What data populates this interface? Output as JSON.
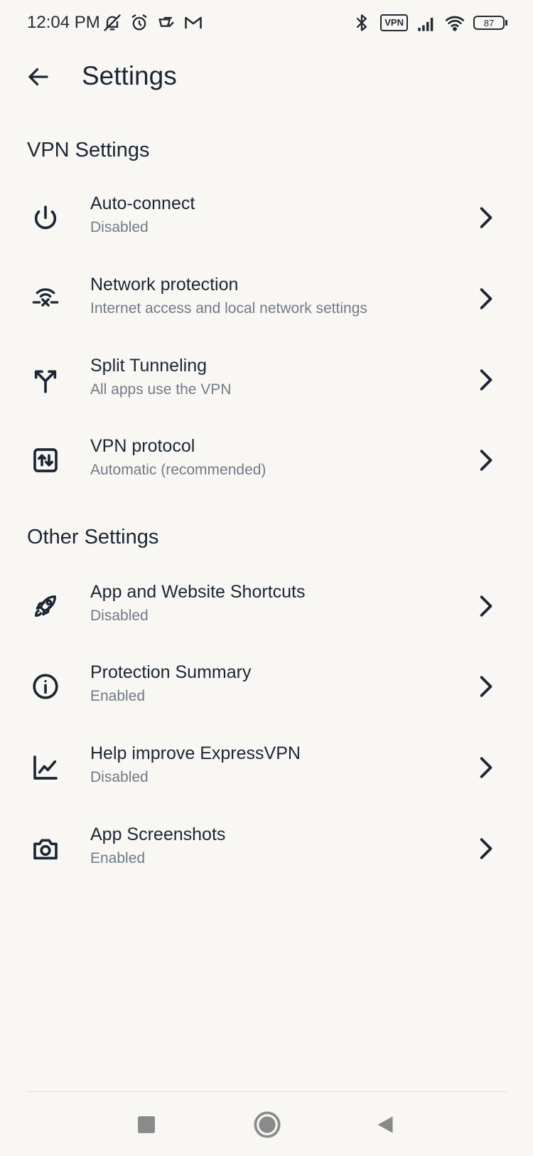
{
  "status_bar": {
    "time": "12:04 PM",
    "vpn_badge": "VPN",
    "battery": "87"
  },
  "header": {
    "title": "Settings"
  },
  "sections": [
    {
      "title": "VPN Settings",
      "items": [
        {
          "title": "Auto-connect",
          "subtitle": "Disabled",
          "icon": "power-icon"
        },
        {
          "title": "Network protection",
          "subtitle": "Internet access and local network settings",
          "icon": "network-protection-icon"
        },
        {
          "title": "Split Tunneling",
          "subtitle": "All apps use the VPN",
          "icon": "split-tunnel-icon"
        },
        {
          "title": "VPN protocol",
          "subtitle": "Automatic (recommended)",
          "icon": "protocol-icon"
        }
      ]
    },
    {
      "title": "Other Settings",
      "items": [
        {
          "title": "App and Website Shortcuts",
          "subtitle": "Disabled",
          "icon": "rocket-icon"
        },
        {
          "title": "Protection Summary",
          "subtitle": "Enabled",
          "icon": "info-icon"
        },
        {
          "title": "Help improve ExpressVPN",
          "subtitle": "Disabled",
          "icon": "chart-icon"
        },
        {
          "title": "App Screenshots",
          "subtitle": "Enabled",
          "icon": "camera-icon"
        }
      ]
    }
  ],
  "colors": {
    "background": "#f9f7f4",
    "text_primary": "#1b2634",
    "text_secondary": "#6f7b87"
  }
}
